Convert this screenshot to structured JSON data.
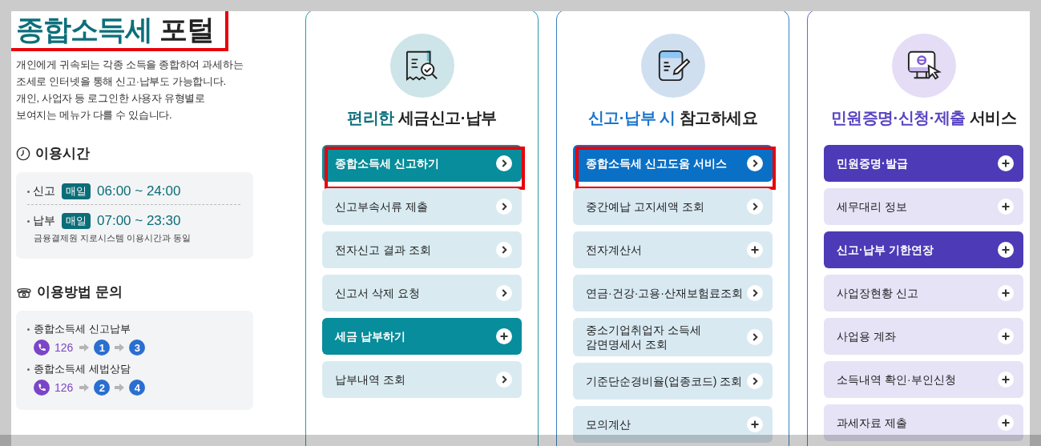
{
  "title": {
    "accent": "종합소득세",
    "rest": "포털",
    "highlighted": true
  },
  "description": "개인에게 귀속되는 각종 소득을 종합하여 과세하는\n조세로 인터넷을 통해 신고·납부도 가능합니다.\n개인, 사업자 등 로그인한 사용자 유형별로\n보여지는 메뉴가 다를 수 있습니다.",
  "hours": {
    "heading": "이용시간",
    "rows": [
      {
        "label": "신고",
        "badge": "매일",
        "time": "06:00 ~ 24:00"
      },
      {
        "label": "납부",
        "badge": "매일",
        "time": "07:00 ~ 23:30",
        "note": "금융결제원 지로시스템 이용시간과 동일"
      }
    ]
  },
  "contact": {
    "heading": "이용방법 문의",
    "entries": [
      {
        "label": "종합소득세 신고납부",
        "phone": "126",
        "steps": [
          "1",
          "3"
        ]
      },
      {
        "label": "종합소득세 세법상담",
        "phone": "126",
        "steps": [
          "2",
          "4"
        ]
      }
    ]
  },
  "cards": [
    {
      "heading_accent": "편리한",
      "heading_rest": "세금신고·납부",
      "items": [
        {
          "label": "종합소득세 신고하기",
          "emphasized": true,
          "kind": "link",
          "highlighted": true
        },
        {
          "label": "신고부속서류 제출",
          "emphasized": false,
          "kind": "link",
          "highlighted": false
        },
        {
          "label": "전자신고 결과 조회",
          "emphasized": false,
          "kind": "link",
          "highlighted": false
        },
        {
          "label": "신고서 삭제 요청",
          "emphasized": false,
          "kind": "link",
          "highlighted": false
        },
        {
          "label": "세금 납부하기",
          "emphasized": true,
          "kind": "expand",
          "highlighted": false
        },
        {
          "label": "납부내역 조회",
          "emphasized": false,
          "kind": "link",
          "highlighted": false
        }
      ]
    },
    {
      "heading_accent": "신고·납부 시",
      "heading_rest": "참고하세요",
      "items": [
        {
          "label": "종합소득세 신고도움 서비스",
          "emphasized": true,
          "kind": "link",
          "highlighted": true
        },
        {
          "label": "중간예납 고지세액 조회",
          "emphasized": false,
          "kind": "link",
          "highlighted": false
        },
        {
          "label": "전자계산서",
          "emphasized": false,
          "kind": "expand",
          "highlighted": false
        },
        {
          "label": "연금·건강·고용·산재보험료조회",
          "emphasized": false,
          "kind": "link",
          "highlighted": false
        },
        {
          "label": "중소기업취업자 소득세\n감면명세서 조회",
          "emphasized": false,
          "kind": "link",
          "highlighted": false
        },
        {
          "label": "기준단순경비율(업종코드) 조회",
          "emphasized": false,
          "kind": "link",
          "highlighted": false
        },
        {
          "label": "모의계산",
          "emphasized": false,
          "kind": "expand",
          "highlighted": false
        }
      ]
    },
    {
      "heading_accent": "민원증명·신청·제출",
      "heading_rest": "서비스",
      "items": [
        {
          "label": "민원증명·발급",
          "emphasized": true,
          "kind": "expand",
          "highlighted": false
        },
        {
          "label": "세무대리 정보",
          "emphasized": false,
          "kind": "expand",
          "highlighted": false
        },
        {
          "label": "신고·납부 기한연장",
          "emphasized": true,
          "kind": "expand",
          "highlighted": false
        },
        {
          "label": "사업장현황 신고",
          "emphasized": false,
          "kind": "expand",
          "highlighted": false
        },
        {
          "label": "사업용 계좌",
          "emphasized": false,
          "kind": "expand",
          "highlighted": false
        },
        {
          "label": "소득내역 확인·부인신청",
          "emphasized": false,
          "kind": "expand",
          "highlighted": false
        },
        {
          "label": "과세자료 제출",
          "emphasized": false,
          "kind": "expand",
          "highlighted": false
        }
      ]
    }
  ]
}
